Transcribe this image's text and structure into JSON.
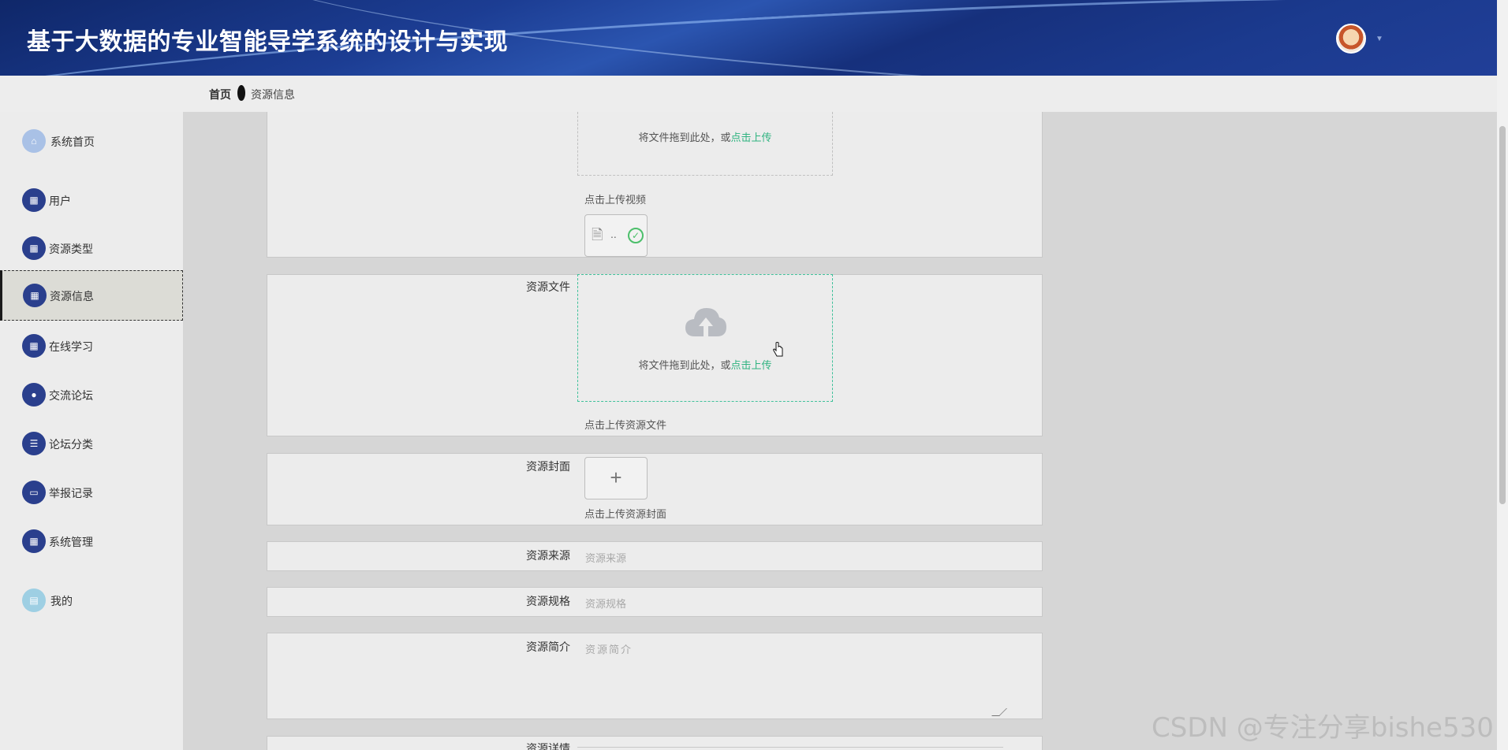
{
  "header": {
    "title": "基于大数据的专业智能导学系统的设计与实现",
    "avatar_icon": "user-avatar",
    "caret_icon": "caret-down-icon"
  },
  "breadcrumb": {
    "home": "首页",
    "current": "资源信息"
  },
  "sidebar": {
    "items": [
      {
        "label": "系统首页",
        "icon": "home-icon"
      },
      {
        "label": "用户",
        "icon": "grid-icon"
      },
      {
        "label": "资源类型",
        "icon": "grid-icon"
      },
      {
        "label": "资源信息",
        "icon": "grid-icon",
        "active": true
      },
      {
        "label": "在线学习",
        "icon": "grid-icon"
      },
      {
        "label": "交流论坛",
        "icon": "bulb-icon"
      },
      {
        "label": "论坛分类",
        "icon": "list-icon"
      },
      {
        "label": "举报记录",
        "icon": "monitor-icon"
      },
      {
        "label": "系统管理",
        "icon": "grid-icon"
      },
      {
        "label": "我的",
        "icon": "card-icon"
      }
    ]
  },
  "form": {
    "video": {
      "drop_text": "将文件拖到此处，或",
      "drop_link": "点击上传",
      "hint": "点击上传视频",
      "file_name": ".."
    },
    "resource_file": {
      "label": "资源文件",
      "drop_text": "将文件拖到此处，或",
      "drop_link": "点击上传",
      "hint": "点击上传资源文件"
    },
    "cover": {
      "label": "资源封面",
      "plus": "+",
      "hint": "点击上传资源封面"
    },
    "source": {
      "label": "资源来源",
      "placeholder": "资源来源"
    },
    "spec": {
      "label": "资源规格",
      "placeholder": "资源规格"
    },
    "intro": {
      "label": "资源简介",
      "placeholder": "资源简介"
    },
    "detail": {
      "label": "资源详情"
    }
  },
  "watermark": "CSDN @专注分享bishe530",
  "colors": {
    "header_bg": "#1c3d93",
    "sidebar_icon": "#2a3f8d",
    "link_green": "#2fb380",
    "active_border": "#3fc19a"
  }
}
